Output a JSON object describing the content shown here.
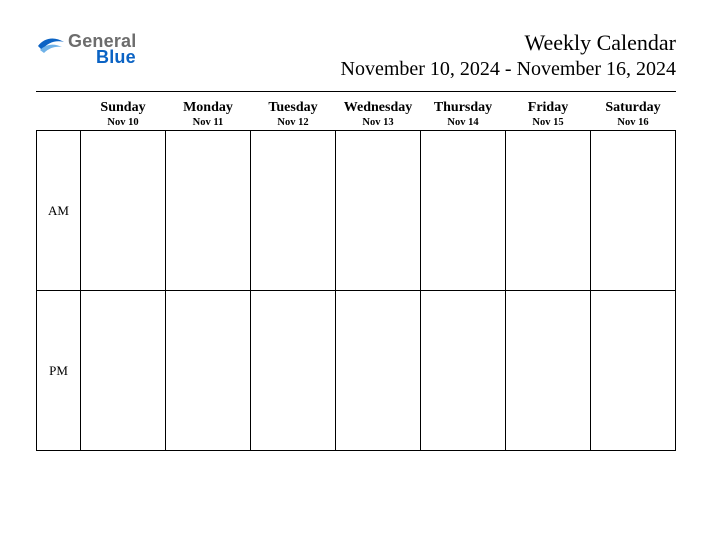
{
  "logo": {
    "line1": "General",
    "line2": "Blue"
  },
  "header": {
    "title": "Weekly Calendar",
    "date_range": "November 10, 2024 - November 16, 2024"
  },
  "time_rows": [
    "AM",
    "PM"
  ],
  "days": [
    {
      "name": "Sunday",
      "date": "Nov 10"
    },
    {
      "name": "Monday",
      "date": "Nov 11"
    },
    {
      "name": "Tuesday",
      "date": "Nov 12"
    },
    {
      "name": "Wednesday",
      "date": "Nov 13"
    },
    {
      "name": "Thursday",
      "date": "Nov 14"
    },
    {
      "name": "Friday",
      "date": "Nov 15"
    },
    {
      "name": "Saturday",
      "date": "Nov 16"
    }
  ]
}
